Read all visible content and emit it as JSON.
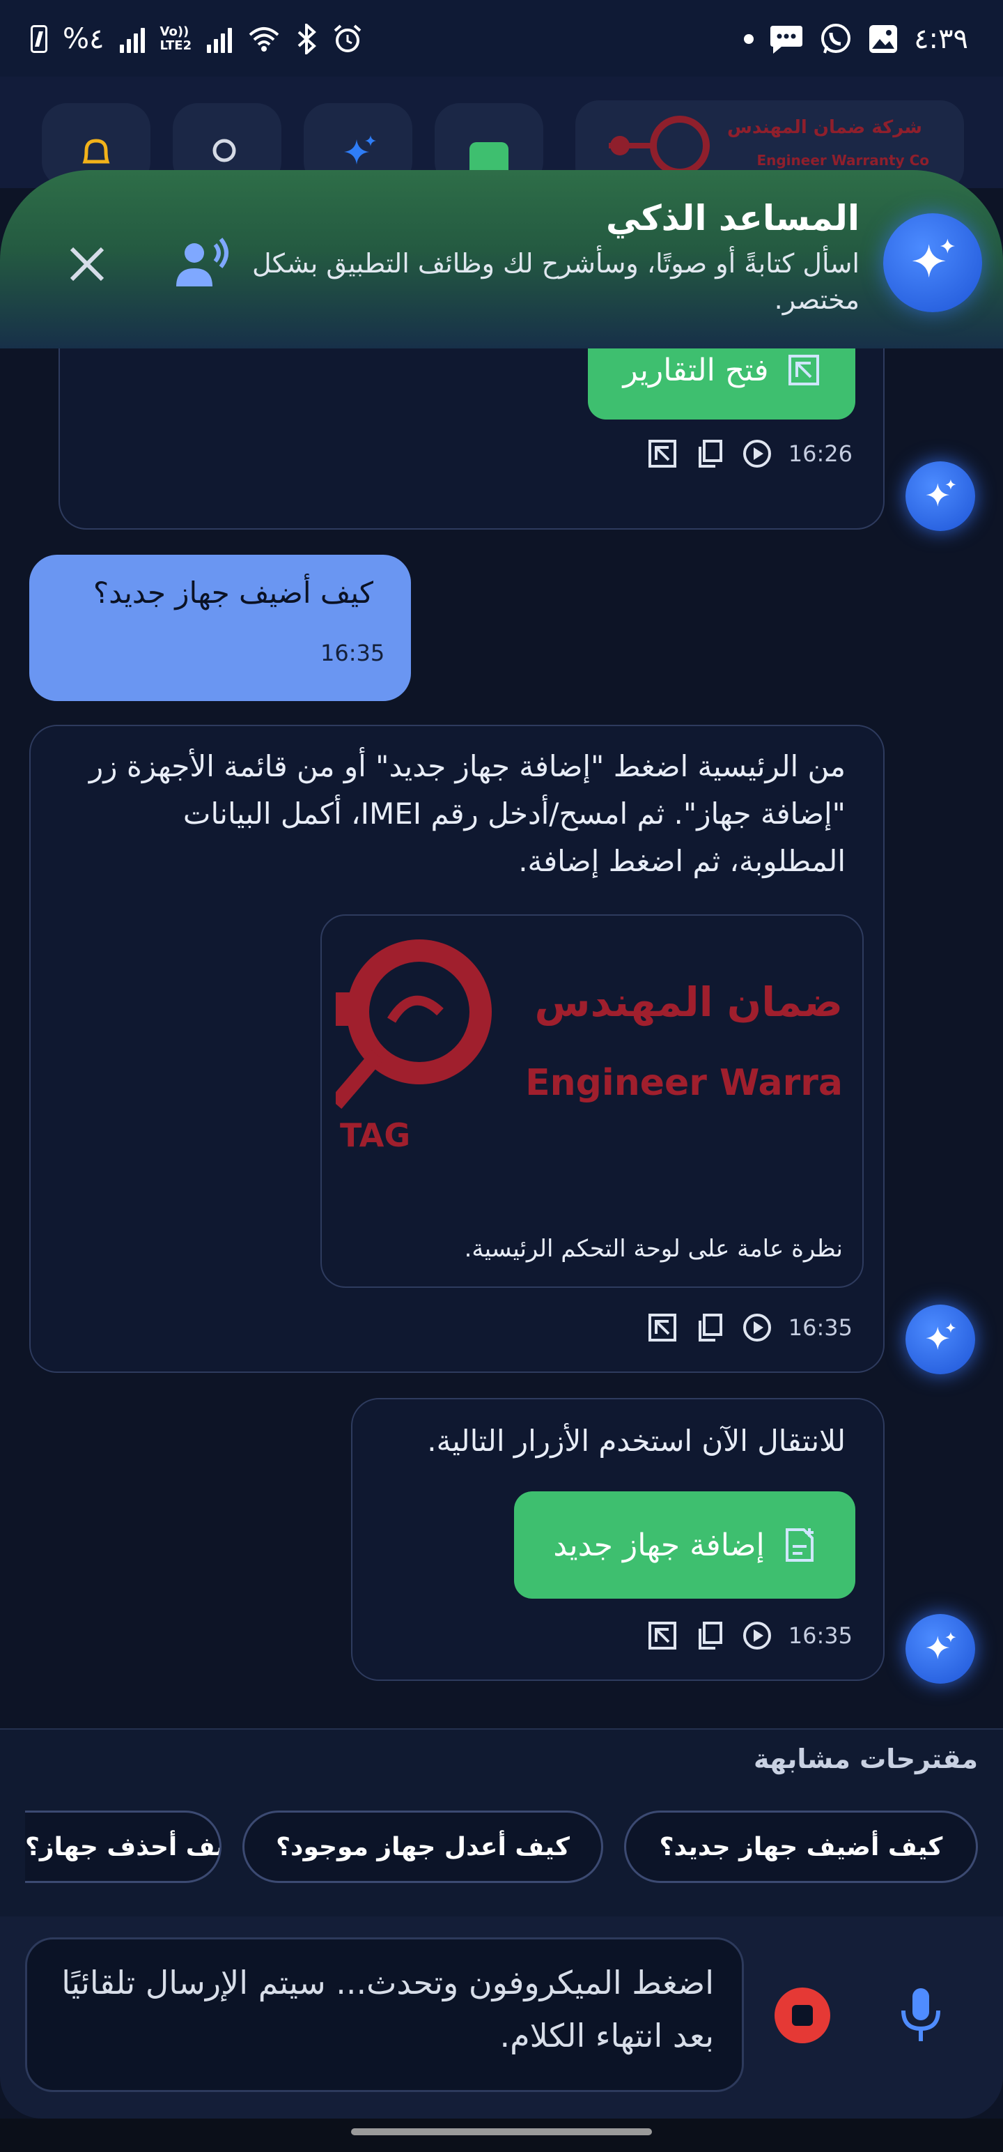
{
  "status_bar": {
    "battery": "%٤",
    "network_label_top": "Vo))",
    "network_label_bottom": "LTE2",
    "time": "٤:٣٩"
  },
  "top_bar": {
    "brand_name_ar": "شركة ضمان المهندس",
    "brand_name_en": "Engineer Warranty Co"
  },
  "assistant": {
    "title": "المساعد الذكي",
    "subtitle": "اسأل كتابةً أو صوتًا، وسأشرح لك وظائف التطبيق بشكل مختصر."
  },
  "messages": {
    "first": {
      "button_label": "فتح التقارير",
      "time": "16:26"
    },
    "user": {
      "text": "كيف أضيف جهاز جديد؟",
      "time": "16:35"
    },
    "answer": {
      "text": "من الرئيسية اضغط \"إضافة جهاز جديد\" أو من قائمة الأجهزة زر \"إضافة جهاز\". ثم امسح/أدخل رقم IMEI، أكمل البيانات المطلوبة، ثم اضغط إضافة.",
      "image_logo_ar": "ضمان المهندس",
      "image_logo_en": "Engineer Warra",
      "image_logo_tag": "TAG",
      "image_caption": "نظرة عامة على لوحة التحكم الرئيسية.",
      "time": "16:35"
    },
    "navigate": {
      "text": "للانتقال الآن استخدم الأزرار التالية.",
      "button_label": "إضافة جهاز جديد",
      "time": "16:35"
    }
  },
  "suggestions": {
    "title": "مقترحات مشابهة",
    "items": [
      "كيف أضيف جهاز جديد؟",
      "كيف أعدل جهاز موجود؟",
      "كيف أحذف جهاز؟"
    ]
  },
  "input": {
    "placeholder": "اضغط الميكروفون وتحدث... سيتم الإرسال تلقائيًا بعد انتهاء الكلام."
  },
  "colors": {
    "accent_green": "#3ebf6f",
    "user_bubble": "#6a96f2",
    "assistant_blue": "#2f6cf0",
    "stop_red": "#e53935"
  },
  "icons": [
    "sparkle-icon",
    "voice-icon",
    "close-icon",
    "open-external-icon",
    "copy-icon",
    "play-icon",
    "microphone-icon",
    "stop-icon",
    "bell-icon",
    "search-icon"
  ]
}
